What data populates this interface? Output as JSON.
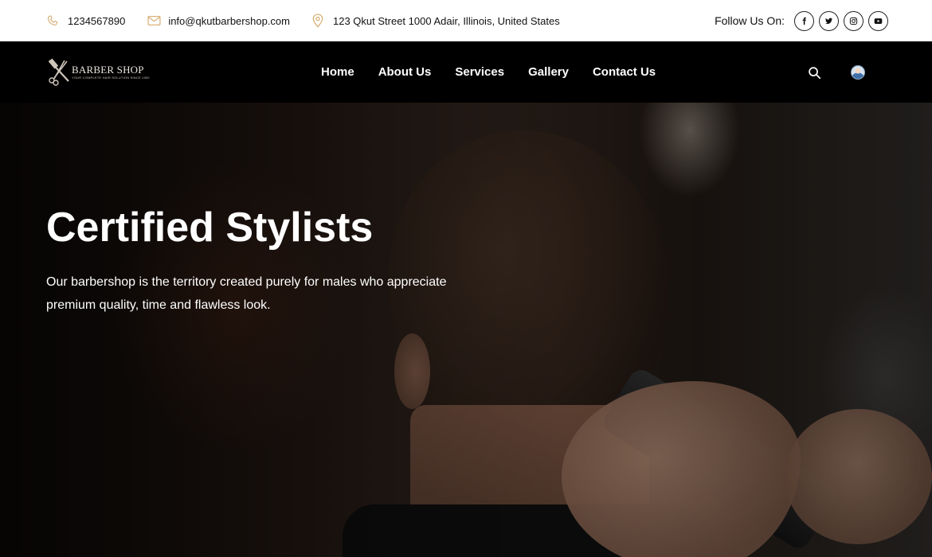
{
  "topbar": {
    "phone": "1234567890",
    "email": "info@qkutbarbershop.com",
    "address": "123 Qkut Street 1000 Adair, Illinois, United States",
    "follow_label": "Follow Us On:",
    "social": [
      {
        "icon": "facebook-icon"
      },
      {
        "icon": "twitter-icon"
      },
      {
        "icon": "instagram-icon"
      },
      {
        "icon": "youtube-icon"
      }
    ]
  },
  "brand": {
    "title": "BARBER SHOP",
    "tagline": "YOUR COMPLETE HAIR SOLUTION SINCE 1952"
  },
  "nav": {
    "items": [
      "Home",
      "About Us",
      "Services",
      "Gallery",
      "Contact Us"
    ]
  },
  "hero": {
    "title": "Certified Stylists",
    "text": "Our barbershop is the territory created purely for males who appreciate premium quality, time and flawless look."
  },
  "colors": {
    "accent": "#d6a96b",
    "topbar_bg": "#ffffff",
    "nav_bg": "#000000"
  }
}
